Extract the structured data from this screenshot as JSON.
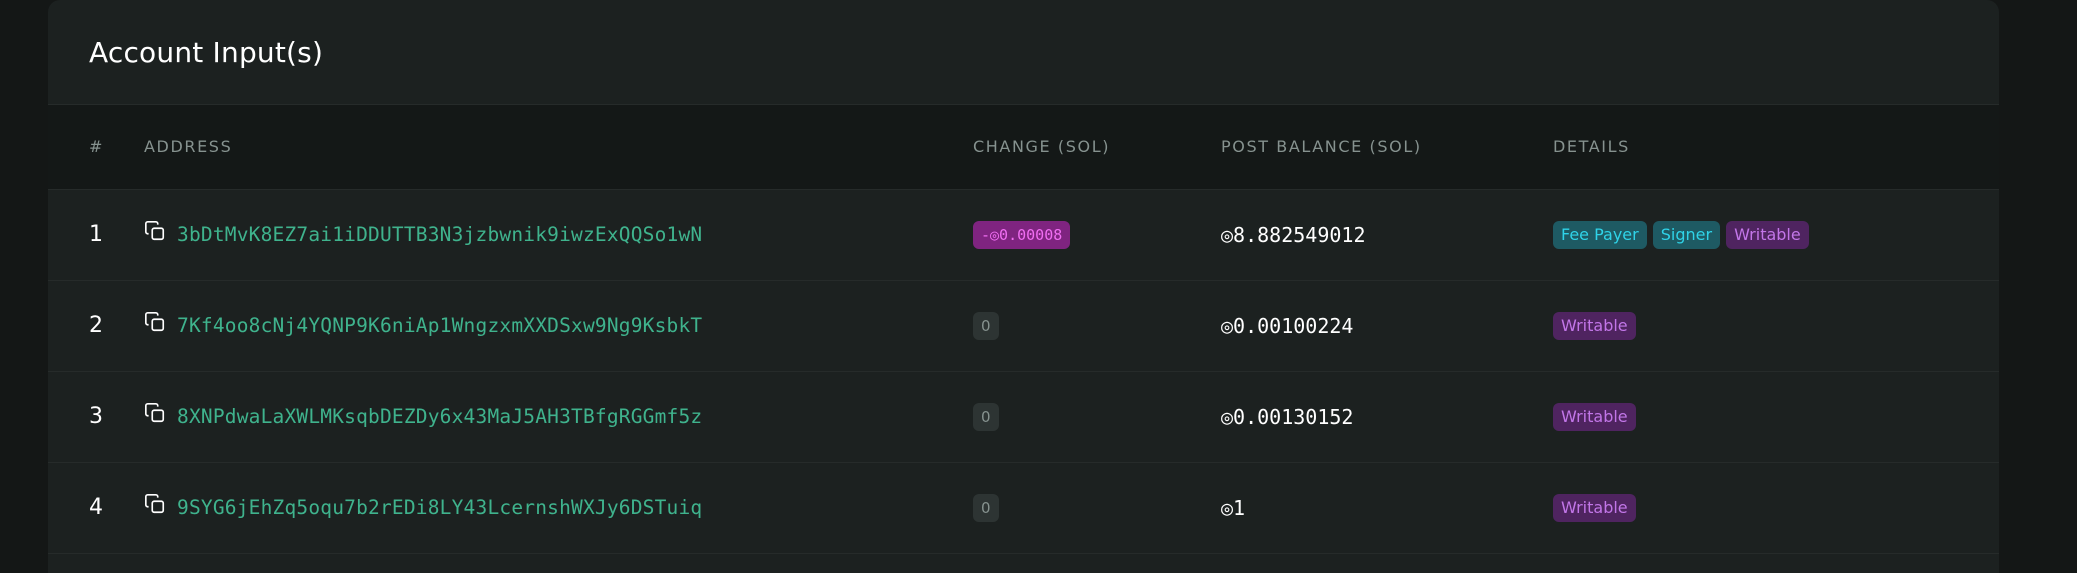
{
  "card": {
    "title": "Account Input(s)"
  },
  "table": {
    "headers": {
      "num": "#",
      "address": "ADDRESS",
      "change": "CHANGE (SOL)",
      "post_balance": "POST BALANCE (SOL)",
      "details": "DETAILS"
    },
    "rows": [
      {
        "num": "1",
        "address": "3bDtMvK8EZ7ai1iDDUTTB3N3jzbwnik9iwzExQQSo1wN",
        "change": "-◎0.00008",
        "change_sign": "negative",
        "post_balance": "◎8.882549012",
        "details": [
          "Fee Payer",
          "Signer",
          "Writable"
        ]
      },
      {
        "num": "2",
        "address": "7Kf4oo8cNj4YQNP9K6niAp1WngzxmXXDSxw9Ng9KsbkT",
        "change": "0",
        "change_sign": "zero",
        "post_balance": "◎0.00100224",
        "details": [
          "Writable"
        ]
      },
      {
        "num": "3",
        "address": "8XNPdwaLaXWLMKsqbDEZDy6x43MaJ5AH3TBfgRGGmf5z",
        "change": "0",
        "change_sign": "zero",
        "post_balance": "◎0.00130152",
        "details": [
          "Writable"
        ]
      },
      {
        "num": "4",
        "address": "9SYG6jEhZq5oqu7b2rEDi8LY43LcernshWXJy6DSTuiq",
        "change": "0",
        "change_sign": "zero",
        "post_balance": "◎1",
        "details": [
          "Writable"
        ]
      }
    ]
  },
  "colors": {
    "address_link": "#3fb38d",
    "negative_badge_bg": "#7f2480",
    "negative_badge_fg": "#f06ef2",
    "fee_payer_bg": "#1e5a63",
    "fee_payer_fg": "#2fd3e8",
    "writable_bg": "#4f2460",
    "writable_fg": "#c276e8"
  },
  "icons": {
    "copy": "copy-icon"
  }
}
